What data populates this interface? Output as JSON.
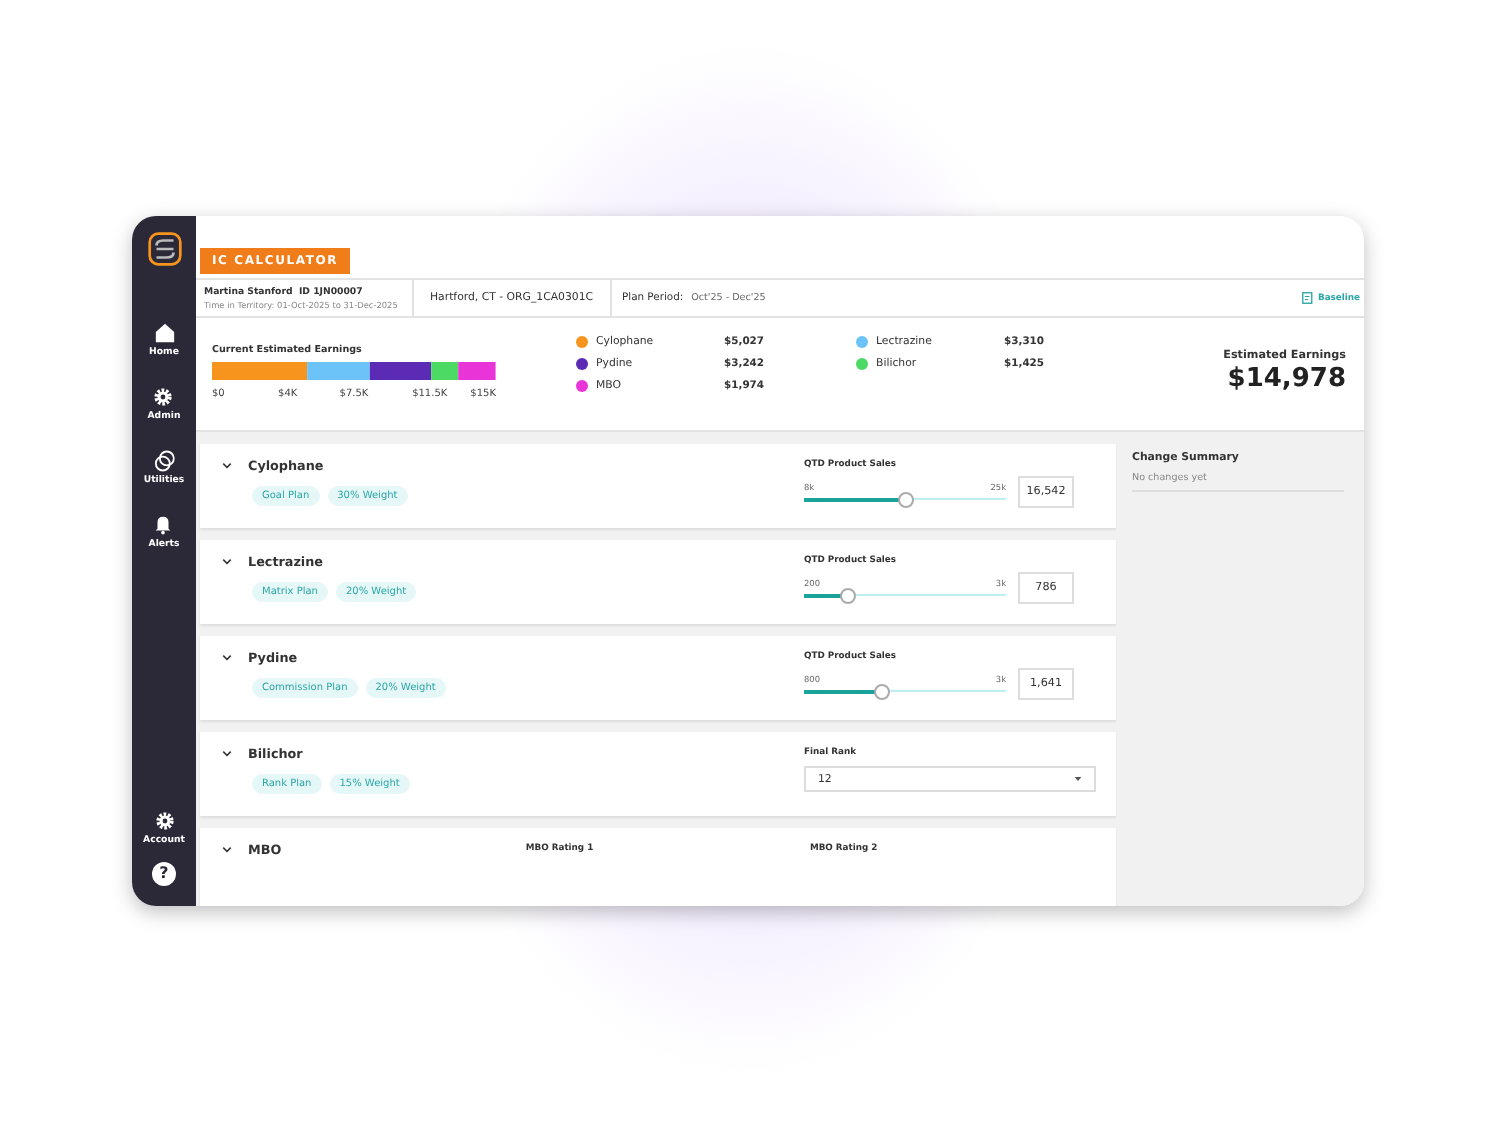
{
  "app": {
    "badge": "IC CALCULATOR"
  },
  "sidebar": {
    "items": [
      {
        "kind": "home",
        "label": "Home"
      },
      {
        "kind": "gear",
        "label": "Admin"
      },
      {
        "kind": "rings",
        "label": "Utilities"
      },
      {
        "kind": "bell",
        "label": "Alerts"
      }
    ],
    "bottom": [
      {
        "kind": "gear",
        "label": "Account"
      }
    ],
    "help": "?"
  },
  "header": {
    "name": "Martina Stanford",
    "id": "ID 1JN00007",
    "territory_time": "Time in Territory: 01-Oct-2025 to 31-Dec-2025",
    "location": "Hartford, CT - ORG_1CA0301C",
    "plan_period_label": "Plan Period:",
    "plan_period": "Oct'25 - Dec'25",
    "baseline": "Baseline"
  },
  "summary": {
    "chart_data": {
      "type": "bar",
      "title": "Current Estimated Earnings",
      "stacked": true,
      "orientation": "horizontal",
      "xlim": [
        0,
        15000
      ],
      "xticks": [
        {
          "value": 0,
          "label": "$0"
        },
        {
          "value": 4000,
          "label": "$4K"
        },
        {
          "value": 7500,
          "label": "$7.5K"
        },
        {
          "value": 11500,
          "label": "$11.5K"
        },
        {
          "value": 15000,
          "label": "$15K"
        }
      ],
      "series": [
        {
          "name": "Cylophane",
          "color": "#f7941d",
          "values": [
            5027
          ]
        },
        {
          "name": "Lectrazine",
          "color": "#6cc3f7",
          "values": [
            3310
          ]
        },
        {
          "name": "Pydine",
          "color": "#5b2bb5",
          "values": [
            3242
          ]
        },
        {
          "name": "Bilichor",
          "color": "#4cd964",
          "values": [
            1425
          ]
        },
        {
          "name": "MBO",
          "color": "#e934d8",
          "values": [
            1974
          ]
        }
      ]
    },
    "legend_amounts": [
      "$5,027",
      "$3,310",
      "$3,242",
      "$1,425",
      "$1,974"
    ],
    "estimated_label": "Estimated Earnings",
    "estimated_value": "$14,978"
  },
  "cards": [
    {
      "kind": "slider",
      "title": "Cylophane",
      "tags": [
        "Goal Plan",
        "30% Weight"
      ],
      "label": "QTD Product Sales",
      "min": "8k",
      "max": "25k",
      "level": 0.5,
      "value": "16,542"
    },
    {
      "kind": "slider",
      "title": "Lectrazine",
      "tags": [
        "Matrix Plan",
        "20% Weight"
      ],
      "label": "QTD Product Sales",
      "min": "200",
      "max": "3k",
      "level": 0.21,
      "value": "786"
    },
    {
      "kind": "slider",
      "title": "Pydine",
      "tags": [
        "Commission Plan",
        "20% Weight"
      ],
      "label": "QTD Product Sales",
      "min": "800",
      "max": "3k",
      "level": 0.38,
      "value": "1,641"
    },
    {
      "kind": "dropdown",
      "title": "Bilichor",
      "tags": [
        "Rank Plan",
        "15% Weight"
      ],
      "label": "Final Rank",
      "value": "12"
    },
    {
      "kind": "ratings",
      "title": "MBO",
      "label_1": "MBO Rating 1",
      "label_2": "MBO Rating 2"
    }
  ],
  "change_summary": {
    "title": "Change Summary",
    "empty": "No changes yet"
  }
}
